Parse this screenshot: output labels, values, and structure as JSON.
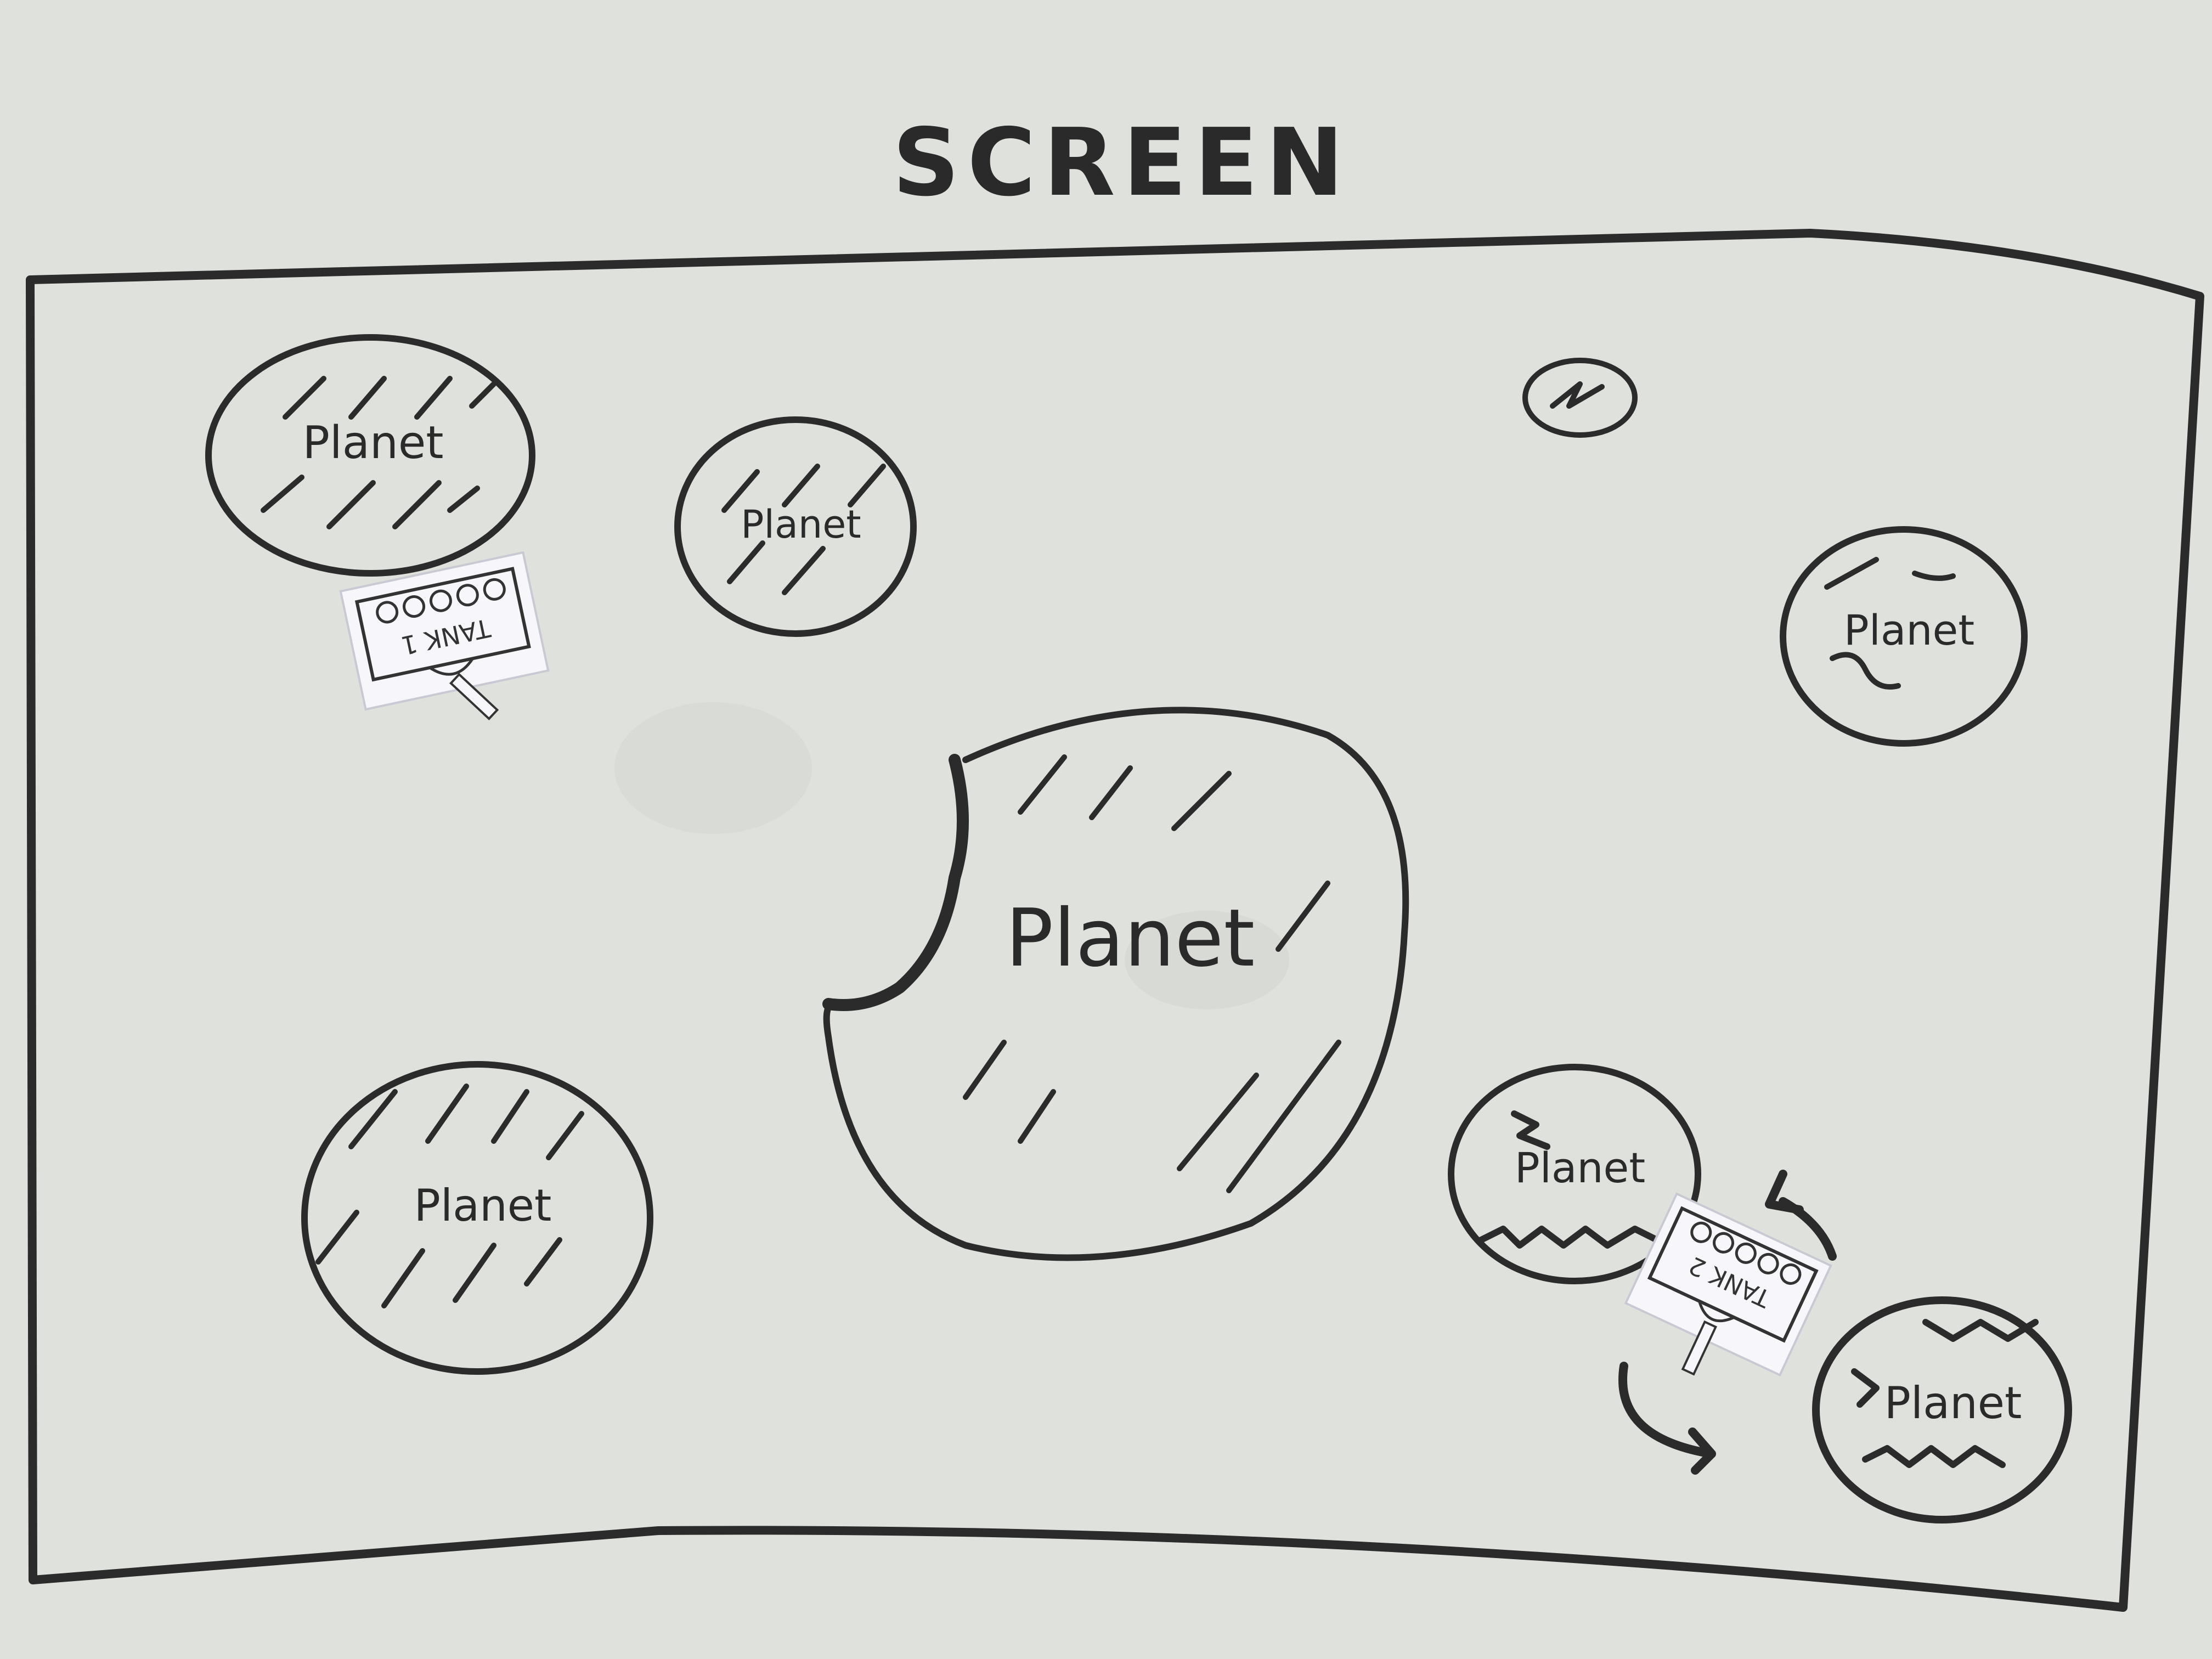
{
  "heading": "SCREEN",
  "planets": [
    {
      "label": "Planet"
    },
    {
      "label": "Planet"
    },
    {
      "label": "Planet"
    },
    {
      "label": "Planet"
    },
    {
      "label": "Planet"
    },
    {
      "label": "Planet"
    },
    {
      "label": "Planet"
    }
  ],
  "tanks": [
    {
      "label": "TANK 1"
    },
    {
      "label": "TANK 2"
    }
  ],
  "colors": {
    "board": "#dfe2dc",
    "marker": "#2b2b2b",
    "paper": "#f7f7fb"
  }
}
